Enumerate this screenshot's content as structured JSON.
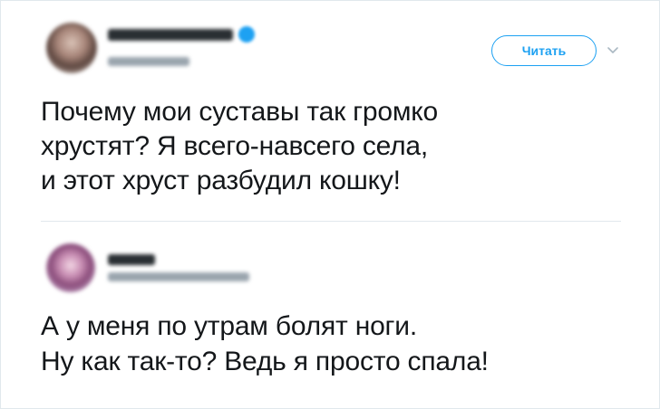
{
  "tweet1": {
    "follow_label": "Читать",
    "text_lines": [
      "Почему мои суставы так громко",
      "хрустят? Я всего-навсего села,",
      "и этот хруст разбудил кошку!"
    ]
  },
  "tweet2": {
    "text_lines": [
      "А у меня по утрам болят ноги.",
      "Ну как так-то? Ведь я просто спала!"
    ]
  },
  "colors": {
    "accent": "#1da1f2",
    "text": "#14171a",
    "divider": "#e1e8ed",
    "secondary": "#9aa5ae"
  },
  "icons": {
    "verified": "verified-badge-icon",
    "chevron": "chevron-down-icon"
  }
}
